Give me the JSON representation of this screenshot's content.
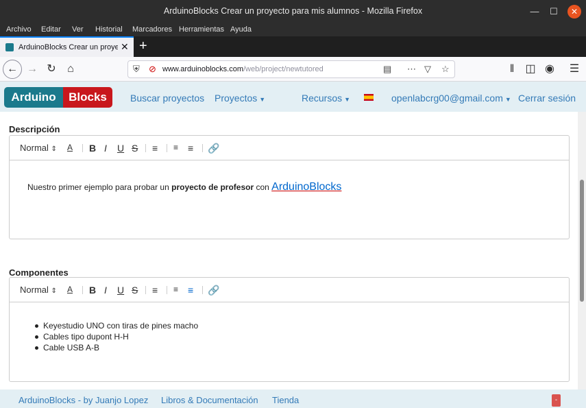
{
  "window": {
    "title": "ArduinoBlocks Crear un proyecto para mis alumnos - Mozilla Firefox"
  },
  "menu": [
    "Archivo",
    "Editar",
    "Ver",
    "Historial",
    "Marcadores",
    "Herramientas",
    "Ayuda"
  ],
  "tab": {
    "label": "ArduinoBlocks Crear un proyecto p"
  },
  "address": {
    "host": "www.arduinoblocks.com",
    "path": "/web/project/newtutored"
  },
  "site": {
    "logo_left": "Arduino",
    "logo_right": "Blocks",
    "nav": {
      "search": "Buscar proyectos",
      "projects": "Proyectos",
      "resources": "Recursos",
      "user": "openlabcrg00@gmail.com",
      "logout": "Cerrar sesión"
    }
  },
  "editor_toolbar": {
    "format": "Normal"
  },
  "description": {
    "title": "Descripción",
    "text_before": "Nuestro primer ejemplo para probar un ",
    "text_bold": "proyecto de profesor",
    "text_mid": " con ",
    "text_link": "ArduinoBlocks"
  },
  "components": {
    "title": "Componentes",
    "items": [
      "Keyestudio UNO con tiras de pines macho",
      "Cables tipo dupont H-H",
      "Cable USB A-B"
    ]
  },
  "footer": {
    "credit": "ArduinoBlocks - by Juanjo Lopez",
    "books": "Libros & Documentación",
    "shop": "Tienda"
  }
}
